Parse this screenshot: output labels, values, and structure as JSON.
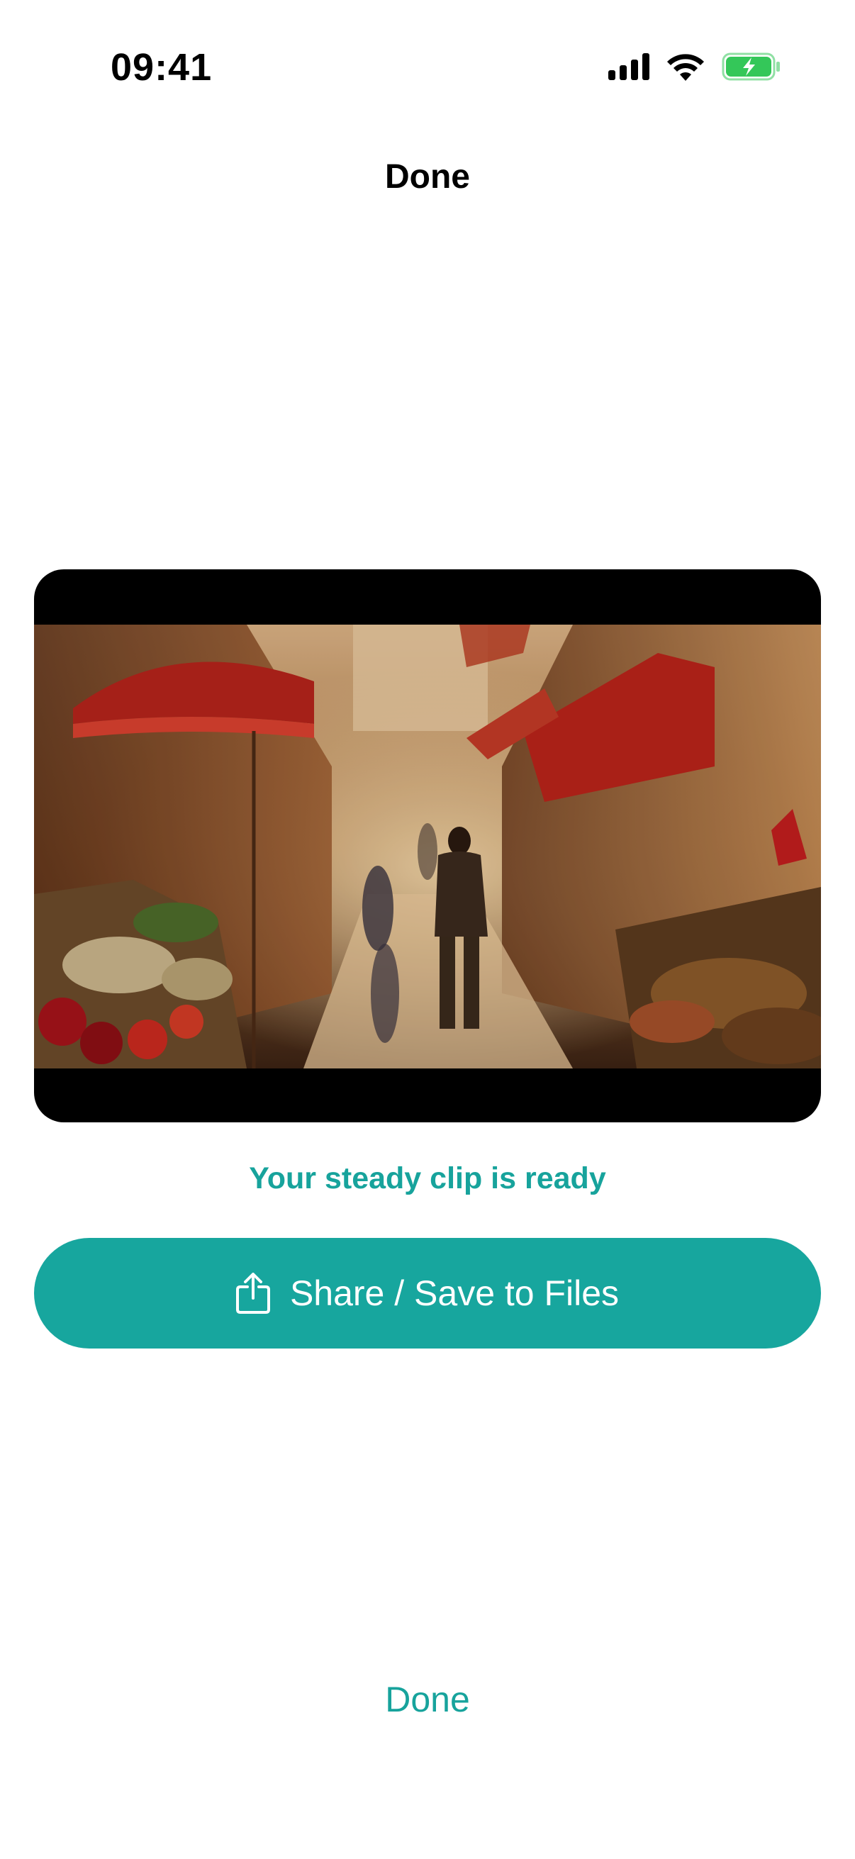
{
  "status_bar": {
    "time": "09:41",
    "icons": [
      "cellular-signal-icon",
      "wifi-icon",
      "battery-charging-icon"
    ],
    "battery_color": "#34c759"
  },
  "header": {
    "title": "Done"
  },
  "preview": {
    "description_icon": "video-thumbnail"
  },
  "status": {
    "message": "Your steady clip is ready"
  },
  "actions": {
    "share_label": "Share / Save to Files",
    "share_icon": "share-icon",
    "done_label": "Done"
  },
  "colors": {
    "accent": "#17a69e",
    "accent_text": "#17a39c",
    "background": "#ffffff"
  }
}
